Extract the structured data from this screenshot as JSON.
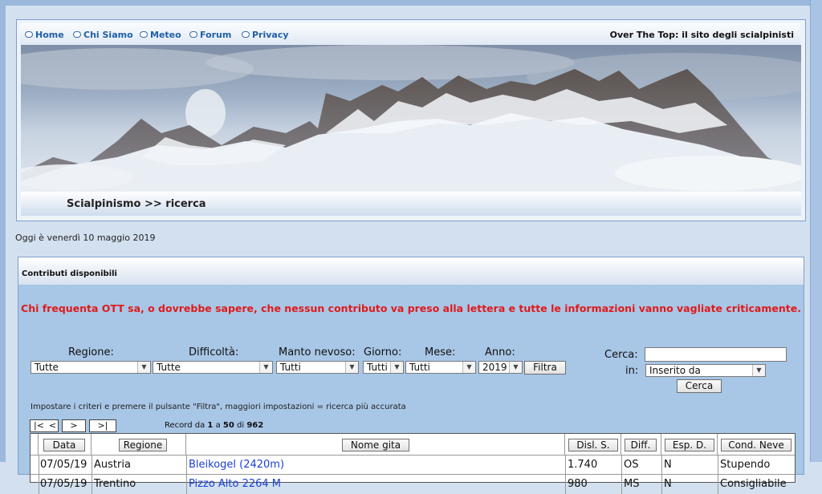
{
  "nav": {
    "items": [
      {
        "label": "Home"
      },
      {
        "label": "Chi Siamo"
      },
      {
        "label": "Meteo"
      },
      {
        "label": "Forum"
      },
      {
        "label": "Privacy"
      }
    ],
    "site_title": "Over The Top: il sito degli scialpinisti"
  },
  "section_title": "Scialpinismo >> ricerca",
  "date_line": "Oggi è venerdì 10 maggio 2019",
  "main": {
    "header": "Contributi disponibili",
    "warning": "Chi frequenta OTT sa, o dovrebbe sapere, che nessun contributo va preso alla lettera e tutte le informazioni vanno vagliate criticamente."
  },
  "filters": {
    "labels": {
      "regione": "Regione:",
      "difficolta": "Difficoltà:",
      "manto": "Manto nevoso:",
      "giorno": "Giorno:",
      "mese": "Mese:",
      "anno": "Anno:"
    },
    "values": {
      "regione": "Tutte",
      "difficolta": "Tutte",
      "manto": "Tutti",
      "giorno": "Tutti",
      "mese": "Tutti",
      "anno": "2019"
    },
    "filter_button": "Filtra",
    "hint": "Impostare i criteri e premere il pulsante \"Filtra\", maggiori impostazioni = ricerca più accurata"
  },
  "search": {
    "label": "Cerca:",
    "in_label": "in:",
    "value": "",
    "in_value": "Inserito da",
    "button": "Cerca"
  },
  "pager": {
    "first": "|<",
    "prev": "<",
    "next": ">",
    "last": ">|",
    "record_prefix": "Record da",
    "from": "1",
    "a": "a",
    "to": "50",
    "di": "di",
    "total": "962"
  },
  "table": {
    "headers": [
      "Data",
      "Regione",
      "Nome gita",
      "Disl. S.",
      "Diff.",
      "Esp. D.",
      "Cond. Neve"
    ],
    "rows": [
      {
        "data": "07/05/19",
        "regione": "Austria",
        "nome": "Bleikogel (2420m)",
        "disl": "1.740",
        "diff": "OS",
        "esp": "N",
        "cond": "Stupendo"
      },
      {
        "data": "07/05/19",
        "regione": "Trentino",
        "nome": "Pizzo Alto 2264 M",
        "disl": "980",
        "diff": "MS",
        "esp": "N",
        "cond": "Consigliabile"
      }
    ]
  }
}
